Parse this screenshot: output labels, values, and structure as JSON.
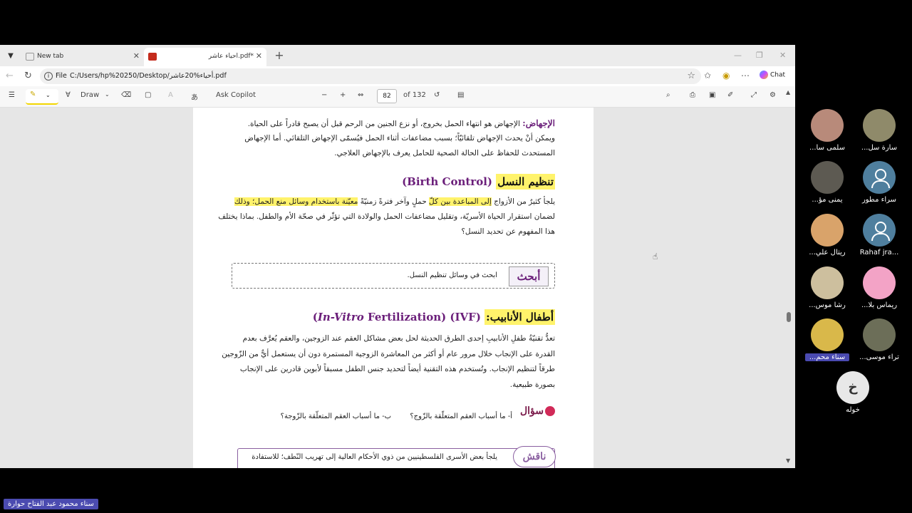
{
  "tabs": [
    {
      "title": "New tab",
      "active": false
    },
    {
      "title": "أحياء عاشر.pdf*",
      "active": true
    }
  ],
  "address": {
    "file_label": "File",
    "url": "C:/Users/hp%20250/Desktop/أحياء%20عاشر.pdf"
  },
  "chat_label": "Chat",
  "pdf_toolbar": {
    "draw_label": "Draw",
    "ask_copilot_label": "Ask Copilot",
    "page_number": "82",
    "page_total": "of 132"
  },
  "page": {
    "abortion_title": "الإجهاض:",
    "abortion_line1": "الإجهاض هو انتهاء الحمل بخروج، أو نزع الجنين من الرحم قبل أن يصبح قادراً على الحياة.",
    "abortion_line2": "ويمكن أنْ يحدث الإجهاض تلقائيّاً؛ بسبب مضاعفات أثناء الحمل فيُسمّى الإجهاض التلقائي. أما الإجهاض",
    "abortion_line3": "المستحدث للحفاظ على الحالة الصحية للحامل يعرف بالإجهاض العلاجي.",
    "birth_control_ar": "تنظيم النسل",
    "birth_control_en": "(Birth Control)",
    "bc_line1_a": "يلجأ كثيرٌ من الأزواج ",
    "bc_line1_b": "إلى المباعدة بين كلّ",
    "bc_line1_c": " حملٍ وآخر فترةً زمنيّةً ",
    "bc_line1_d": "معيّنة باستخدام وسائل منع الحمل؛ وذلك",
    "bc_line2": "لضمان استقرار الحياة الأسريّة، وتقليل مضاعفات الحمل والولادة التي تؤثّر في صحّة الأم والطفل. بماذا يختلف",
    "bc_line3": "هذا المفهوم عن تحديد النسل؟",
    "research_badge": "أبحث",
    "research_text": "ابحث في وسائل تنظيم النسل.",
    "ivf_ar": "أطفال الأنابيب:",
    "ivf_en_italic": "In-Vitro",
    "ivf_en_rest": "Fertilization) (IVF)",
    "ivf_en_open": "(",
    "ivf_line1": "تعدُّ تقنيّةُ طفلِ الأنابيبِ إحدى الطرق الحديثة لحل بعض مشاكل العقم عند الزوجين، والعقم يُعرَّف بعدم",
    "ivf_line2": "القدرة على الإنجاب خلال مرور عام أو أكثر من المعاشرة الزوجية المستمرة دون أن يستعمل أيٌّ من الزّوجين",
    "ivf_line3": "طرقاً لتنظيم الإنجاب. وتُستخدم هذه التقنية أيضاً لتحديد جنس الطفل مسبقاً لأبوين قادرين على الإنجاب",
    "ivf_line4": "بصورة طبيعية.",
    "question_badge": "سؤال",
    "question_a": "أ- ما أسباب العقم المتعلّقة بالزّوج؟",
    "question_b": "ب- ما أسباب العقم المتعلّقة بالزّوجة؟",
    "discuss_badge": "ناقش",
    "discuss_text": "يلجأ بعض الأسرى الفلسطينيين من ذوي الأحكام العالية إلى تهريب النّطف؛ للاستفادة"
  },
  "participants": [
    {
      "name": "سلمى سا...",
      "type": "photo",
      "color": "#b88a7a"
    },
    {
      "name": "سارة سل...",
      "type": "photo",
      "color": "#8f8a6a"
    },
    {
      "name": "يمنى مؤ...",
      "type": "photo",
      "color": "#5d5a52"
    },
    {
      "name": "سراء مطور",
      "type": "generic"
    },
    {
      "name": "ريتال علي...",
      "type": "photo",
      "color": "#d9a36a"
    },
    {
      "name": "Rahaf jra...",
      "type": "generic"
    },
    {
      "name": "رشا موس...",
      "type": "photo",
      "color": "#cdbf9e"
    },
    {
      "name": "ريماس بلا...",
      "type": "photo",
      "color": "#f3a3c6"
    },
    {
      "name": "سناء محم...",
      "type": "photo",
      "color": "#d9b84a"
    },
    {
      "name": "تراء موسى...",
      "type": "photo",
      "color": "#6c6e58"
    },
    {
      "name": "خوله",
      "type": "letter",
      "letter": "خ"
    }
  ],
  "presenter_name": "سناء محمود عبد الفتاح حوارة"
}
